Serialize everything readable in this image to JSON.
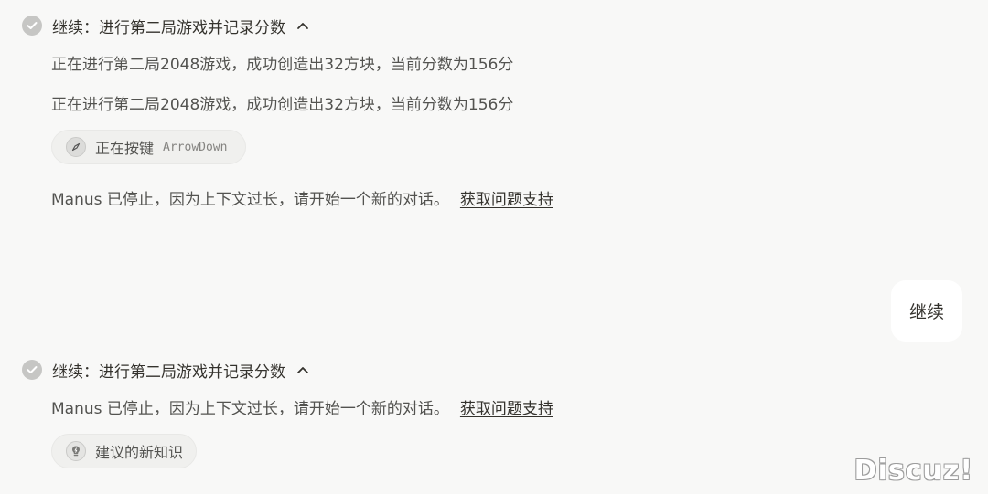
{
  "steps": [
    {
      "title": "继续：进行第二局游戏并记录分数",
      "lines": [
        "正在进行第二局2048游戏，成功创造出32方块，当前分数为156分",
        "正在进行第二局2048游戏，成功创造出32方块，当前分数为156分"
      ],
      "tool": {
        "label": "正在按键",
        "code": "ArrowDown",
        "icon": "compass-icon"
      },
      "stopped_text": "Manus 已停止，因为上下文过长，请开始一个新的对话。",
      "support_link": "获取问题支持"
    },
    {
      "title": "继续：进行第二局游戏并记录分数",
      "stopped_text": "Manus 已停止，因为上下文过长，请开始一个新的对话。",
      "support_link": "获取问题支持",
      "suggestion": {
        "label": "建议的新知识",
        "icon": "lightbulb-icon"
      }
    }
  ],
  "user_message": "继续",
  "watermark": "Discuz!",
  "colors": {
    "background": "#f8f8f7",
    "text": "#34322d",
    "muted": "#535350",
    "check": "#c6c6c4"
  }
}
